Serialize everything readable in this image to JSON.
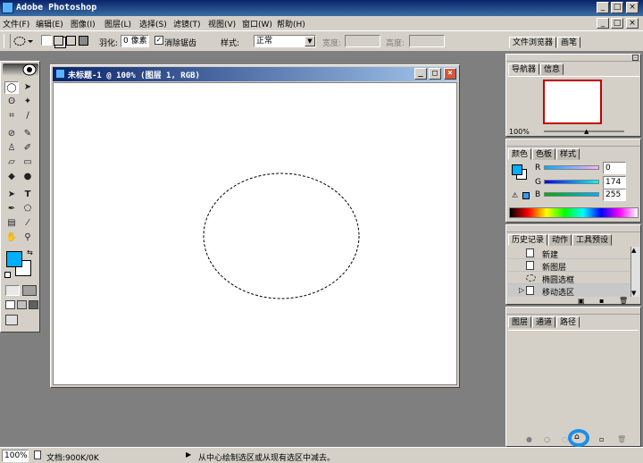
{
  "app": {
    "title": "Adobe Photoshop"
  },
  "menu": [
    "文件(F)",
    "编辑(E)",
    "图像(I)",
    "图层(L)",
    "选择(S)",
    "滤镜(T)",
    "视图(V)",
    "窗口(W)",
    "帮助(H)"
  ],
  "options": {
    "feather_label": "羽化:",
    "feather_value": "0 像素",
    "antialias_label": "消除锯齿",
    "style_label": "样式:",
    "style_value": "正常",
    "width_label": "宽度:",
    "height_label": "高度:",
    "right_tabs": [
      "文件浏览器",
      "画笔"
    ]
  },
  "document": {
    "title": "未标题-1 @ 100% (图层 1, RGB)"
  },
  "navigator": {
    "tabs": [
      "导航器",
      "信息"
    ],
    "zoom": "100%"
  },
  "color": {
    "tabs": [
      "颜色",
      "色板",
      "样式"
    ],
    "r_label": "R",
    "g_label": "G",
    "b_label": "B",
    "r": "0",
    "g": "174",
    "b": "255",
    "swatch": "#00aeff"
  },
  "history": {
    "tabs": [
      "历史记录",
      "动作",
      "工具预设"
    ],
    "items": [
      "新建",
      "新图层",
      "椭圆选框",
      "移动选区"
    ]
  },
  "layers": {
    "tabs": [
      "图层",
      "通道",
      "路径"
    ]
  },
  "status": {
    "zoom": "100%",
    "doc_info": "文档:900K/0K",
    "hint": "从中心绘制选区或从现有选区中减去。"
  }
}
